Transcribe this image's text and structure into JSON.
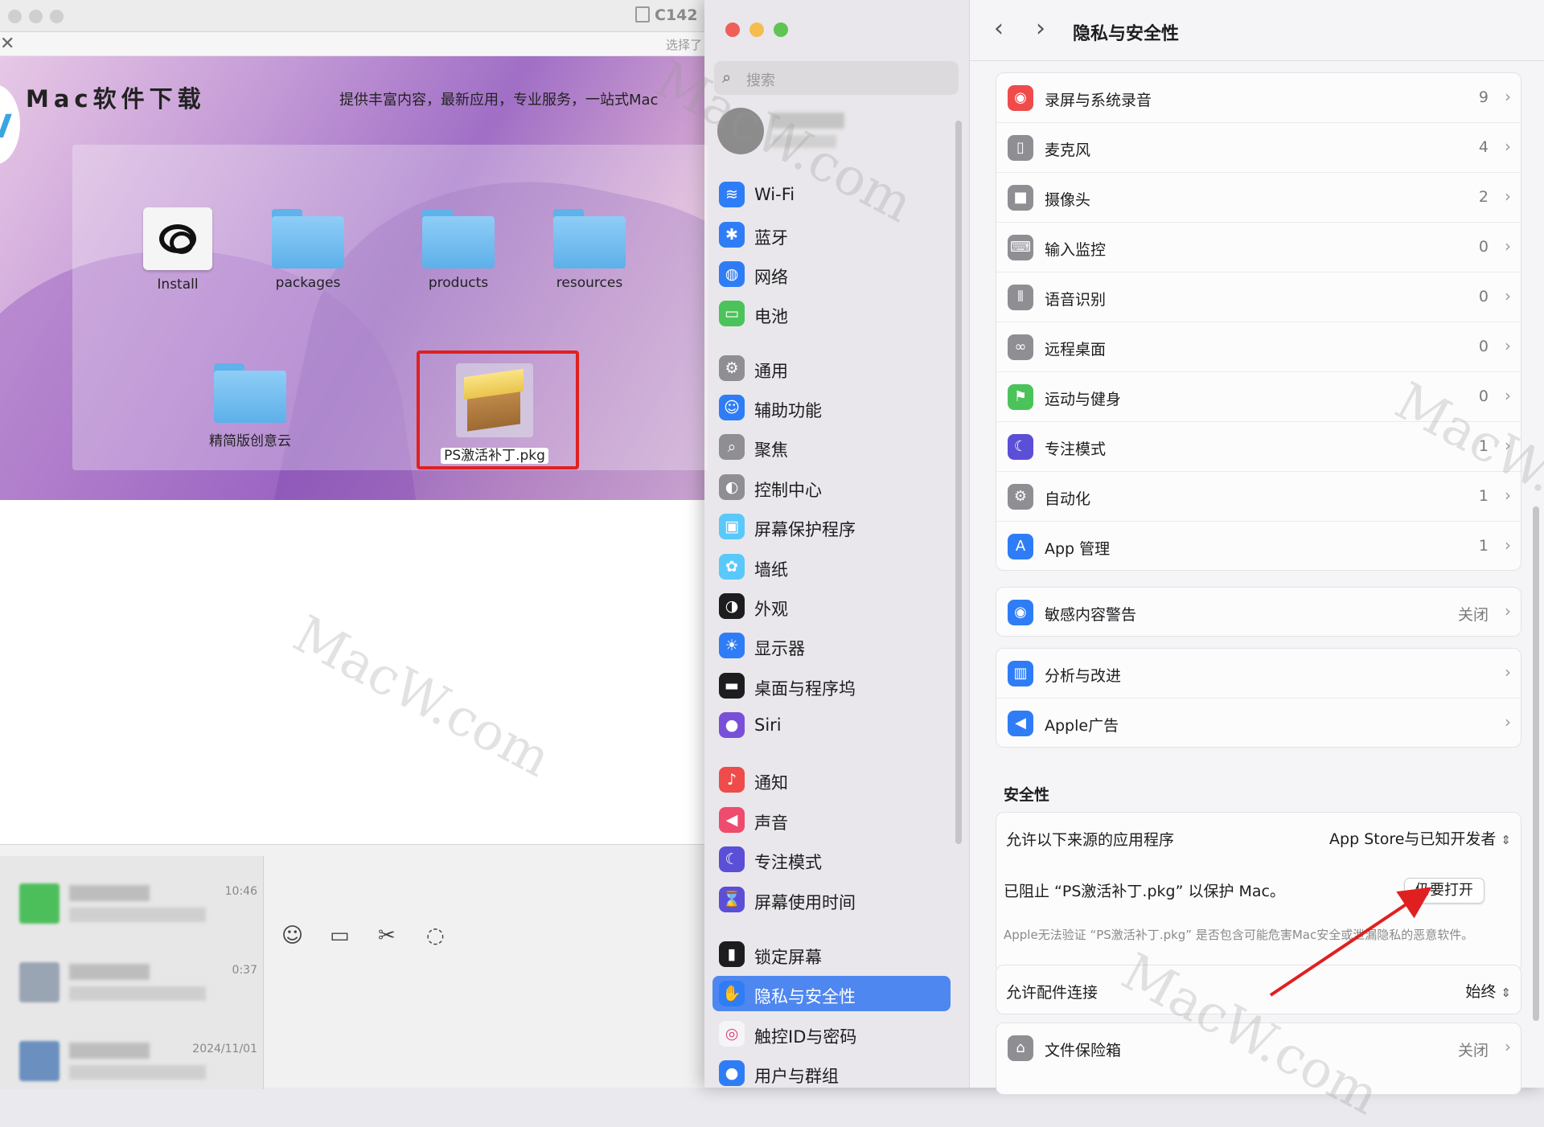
{
  "dmg": {
    "title": "C142",
    "select_hint": "选择了",
    "brand": "Mac软件下载",
    "tagline": "提供丰富内容，最新应用，专业服务，一站式Mac",
    "logo_glyph": "V",
    "items": [
      {
        "label": "Install",
        "icon": "creative-cloud-icon"
      },
      {
        "label": "packages",
        "icon": "folder-icon"
      },
      {
        "label": "products",
        "icon": "folder-icon"
      },
      {
        "label": "resources",
        "icon": "folder-icon"
      },
      {
        "label": "精简版创意云",
        "icon": "folder-icon"
      },
      {
        "label": "PS激活补丁.pkg",
        "icon": "package-icon"
      }
    ]
  },
  "chat": {
    "times": [
      "10:46",
      "0:37",
      "2024/11/01"
    ],
    "toolbar_icons": [
      "emoji-icon",
      "folder-icon",
      "scissors-icon",
      "chat-bubble-icon"
    ]
  },
  "settings": {
    "search_placeholder": "搜索",
    "sidebar": [
      {
        "label": "Wi-Fi",
        "icon": "wifi-icon",
        "color": "#2f7df6",
        "glyph": "≋"
      },
      {
        "label": "蓝牙",
        "icon": "bluetooth-icon",
        "color": "#2f7df6",
        "glyph": "✱"
      },
      {
        "label": "网络",
        "icon": "globe-icon",
        "color": "#2f7df6",
        "glyph": "◍"
      },
      {
        "label": "电池",
        "icon": "battery-icon",
        "color": "#4cc35a",
        "glyph": "▭"
      },
      {
        "label": "通用",
        "icon": "gear-icon",
        "color": "#8e8e93",
        "glyph": "⚙"
      },
      {
        "label": "辅助功能",
        "icon": "accessibility-icon",
        "color": "#2f7df6",
        "glyph": "☺"
      },
      {
        "label": "聚焦",
        "icon": "magnifier-icon",
        "color": "#8e8e93",
        "glyph": "⌕"
      },
      {
        "label": "控制中心",
        "icon": "control-center-icon",
        "color": "#8e8e93",
        "glyph": "◐"
      },
      {
        "label": "屏幕保护程序",
        "icon": "screensaver-icon",
        "color": "#5ac8fa",
        "glyph": "▣"
      },
      {
        "label": "墙纸",
        "icon": "wallpaper-icon",
        "color": "#5ac8fa",
        "glyph": "✿"
      },
      {
        "label": "外观",
        "icon": "appearance-icon",
        "color": "#1d1d1f",
        "glyph": "◑"
      },
      {
        "label": "显示器",
        "icon": "display-icon",
        "color": "#2f7df6",
        "glyph": "☀"
      },
      {
        "label": "桌面与程序坞",
        "icon": "dock-icon",
        "color": "#1d1d1f",
        "glyph": "▬"
      },
      {
        "label": "Siri",
        "icon": "siri-icon",
        "color": "#7a4fd8",
        "glyph": "●"
      },
      {
        "label": "通知",
        "icon": "bell-icon",
        "color": "#ef4b4b",
        "glyph": "♪"
      },
      {
        "label": "声音",
        "icon": "speaker-icon",
        "color": "#ef4b6f",
        "glyph": "◀"
      },
      {
        "label": "专注模式",
        "icon": "moon-icon",
        "color": "#5b4fd8",
        "glyph": "☾"
      },
      {
        "label": "屏幕使用时间",
        "icon": "hourglass-icon",
        "color": "#5b4fd8",
        "glyph": "⌛"
      },
      {
        "label": "锁定屏幕",
        "icon": "lock-icon",
        "color": "#1d1d1f",
        "glyph": "▮"
      },
      {
        "label": "隐私与安全性",
        "icon": "hand-icon",
        "color": "#2f7df6",
        "glyph": "✋"
      },
      {
        "label": "触控ID与密码",
        "icon": "fingerprint-icon",
        "color": "#f5f5f7",
        "glyph": "◎"
      },
      {
        "label": "用户与群组",
        "icon": "users-icon",
        "color": "#2f7df6",
        "glyph": "●"
      }
    ],
    "title": "隐私与安全性",
    "privacy_rows": [
      {
        "label": "录屏与系统录音",
        "value": "9",
        "icon": "screen-record-icon",
        "color": "#ef4b4b",
        "glyph": "◉"
      },
      {
        "label": "麦克风",
        "value": "4",
        "icon": "microphone-icon",
        "color": "#8e8e93",
        "glyph": "▯"
      },
      {
        "label": "摄像头",
        "value": "2",
        "icon": "camera-icon",
        "color": "#8e8e93",
        "glyph": "■"
      },
      {
        "label": "输入监控",
        "value": "0",
        "icon": "keyboard-icon",
        "color": "#8e8e93",
        "glyph": "⌨"
      },
      {
        "label": "语音识别",
        "value": "0",
        "icon": "waveform-icon",
        "color": "#8e8e93",
        "glyph": "⦀"
      },
      {
        "label": "远程桌面",
        "value": "0",
        "icon": "binoculars-icon",
        "color": "#8e8e93",
        "glyph": "∞"
      },
      {
        "label": "运动与健身",
        "value": "0",
        "icon": "fitness-icon",
        "color": "#4cc35a",
        "glyph": "⚑"
      },
      {
        "label": "专注模式",
        "value": "1",
        "icon": "moon-icon",
        "color": "#5b4fd8",
        "glyph": "☾"
      },
      {
        "label": "自动化",
        "value": "1",
        "icon": "gears-icon",
        "color": "#8e8e93",
        "glyph": "⚙"
      },
      {
        "label": "App 管理",
        "value": "1",
        "icon": "appstore-icon",
        "color": "#2f7df6",
        "glyph": "A"
      }
    ],
    "sensitive": {
      "label": "敏感内容警告",
      "value": "关闭",
      "icon": "eye-icon",
      "color": "#2f7df6",
      "glyph": "◉"
    },
    "analytics": {
      "label": "分析与改进",
      "icon": "chart-icon",
      "color": "#2f7df6",
      "glyph": "▥"
    },
    "ads": {
      "label": "Apple广告",
      "icon": "megaphone-icon",
      "color": "#2f7df6",
      "glyph": "◀"
    },
    "security_title": "安全性",
    "allow_apps": {
      "label": "允许以下来源的应用程序",
      "value": "App Store与已知开发者"
    },
    "blocked": {
      "text": "已阻止 “PS激活补丁.pkg” 以保护 Mac。",
      "button": "仍要打开",
      "description": "Apple无法验证 “PS激活补丁.pkg” 是否包含可能危害Mac安全或泄漏隐私的恶意软件。"
    },
    "accessories": {
      "label": "允许配件连接",
      "value": "始终"
    },
    "filevault": {
      "label": "文件保险箱",
      "value": "关闭",
      "icon": "vault-icon",
      "color": "#8e8e93",
      "glyph": "⌂"
    }
  },
  "watermark": "MacW.com"
}
